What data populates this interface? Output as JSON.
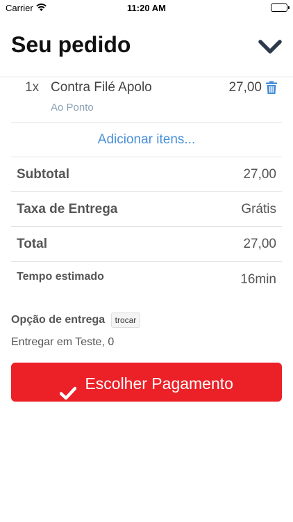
{
  "status_bar": {
    "carrier": "Carrier",
    "time": "11:20 AM",
    "icons": [
      "wifi-icon",
      "battery-icon"
    ]
  },
  "header": {
    "title": "Seu pedido",
    "collapse_icon": "chevron-down-icon"
  },
  "order_items": [
    {
      "qty": "1x",
      "name": "Contra Filé Apolo",
      "option": "Ao Ponto",
      "price": "27,00",
      "delete_icon": "trash-icon"
    }
  ],
  "add_items_label": "Adicionar itens...",
  "summary": {
    "subtotal_label": "Subtotal",
    "subtotal_value": "27,00",
    "taxa_label": "Taxa de Entrega",
    "taxa_value": "Grátis",
    "total_label": "Total",
    "total_value": "27,00",
    "tempo_label": "Tempo estimado",
    "tempo_value": "16min"
  },
  "delivery": {
    "option_label": "Opção de entrega",
    "swap_label": "trocar",
    "address": "Entregar em Teste, 0"
  },
  "payment_button": {
    "label": "Escolher Pagamento",
    "icon": "check-icon"
  },
  "colors": {
    "accent_red": "#ec2027",
    "link_blue": "#4a90d9",
    "option_gray_blue": "#8a9fb3",
    "text_dark": "#111111",
    "chevron_navy": "#2d3a4b"
  }
}
